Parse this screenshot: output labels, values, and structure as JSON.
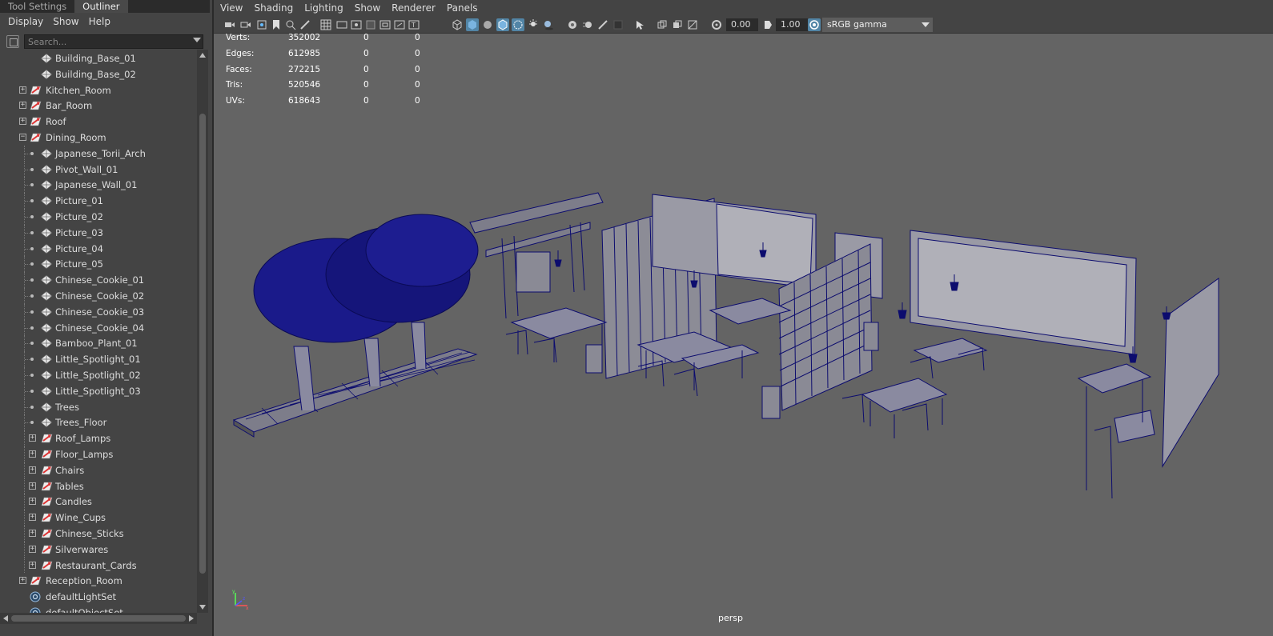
{
  "left_panel": {
    "tabs": [
      "Tool Settings",
      "Outliner"
    ],
    "menu": [
      "Display",
      "Show",
      "Help"
    ],
    "search_placeholder": "Search...",
    "items": [
      {
        "label": "Building_Base_01",
        "level": 1,
        "type": "mesh",
        "expander": "none"
      },
      {
        "label": "Building_Base_02",
        "level": 1,
        "type": "mesh",
        "expander": "none"
      },
      {
        "label": "Kitchen_Room",
        "level": 0,
        "type": "group",
        "expander": "plus"
      },
      {
        "label": "Bar_Room",
        "level": 0,
        "type": "group",
        "expander": "plus"
      },
      {
        "label": "Roof",
        "level": 0,
        "type": "group",
        "expander": "plus"
      },
      {
        "label": "Dining_Room",
        "level": 0,
        "type": "group",
        "expander": "minus"
      },
      {
        "label": "Japanese_Torii_Arch",
        "level": 2,
        "type": "mesh",
        "expander": "none"
      },
      {
        "label": "Pivot_Wall_01",
        "level": 2,
        "type": "mesh",
        "expander": "none"
      },
      {
        "label": "Japanese_Wall_01",
        "level": 2,
        "type": "mesh",
        "expander": "none"
      },
      {
        "label": "Picture_01",
        "level": 2,
        "type": "mesh",
        "expander": "none"
      },
      {
        "label": "Picture_02",
        "level": 2,
        "type": "mesh",
        "expander": "none"
      },
      {
        "label": "Picture_03",
        "level": 2,
        "type": "mesh",
        "expander": "none"
      },
      {
        "label": "Picture_04",
        "level": 2,
        "type": "mesh",
        "expander": "none"
      },
      {
        "label": "Picture_05",
        "level": 2,
        "type": "mesh",
        "expander": "none"
      },
      {
        "label": "Chinese_Cookie_01",
        "level": 2,
        "type": "mesh",
        "expander": "none"
      },
      {
        "label": "Chinese_Cookie_02",
        "level": 2,
        "type": "mesh",
        "expander": "none"
      },
      {
        "label": "Chinese_Cookie_03",
        "level": 2,
        "type": "mesh",
        "expander": "none"
      },
      {
        "label": "Chinese_Cookie_04",
        "level": 2,
        "type": "mesh",
        "expander": "none"
      },
      {
        "label": "Bamboo_Plant_01",
        "level": 2,
        "type": "mesh",
        "expander": "none"
      },
      {
        "label": "Little_Spotlight_01",
        "level": 2,
        "type": "mesh",
        "expander": "none"
      },
      {
        "label": "Little_Spotlight_02",
        "level": 2,
        "type": "mesh",
        "expander": "none"
      },
      {
        "label": "Little_Spotlight_03",
        "level": 2,
        "type": "mesh",
        "expander": "none"
      },
      {
        "label": "Trees",
        "level": 2,
        "type": "mesh",
        "expander": "none"
      },
      {
        "label": "Trees_Floor",
        "level": 2,
        "type": "mesh",
        "expander": "none"
      },
      {
        "label": "Roof_Lamps",
        "level": 1,
        "type": "group",
        "expander": "plus"
      },
      {
        "label": "Floor_Lamps",
        "level": 1,
        "type": "group",
        "expander": "plus"
      },
      {
        "label": "Chairs",
        "level": 1,
        "type": "group",
        "expander": "plus"
      },
      {
        "label": "Tables",
        "level": 1,
        "type": "group",
        "expander": "plus"
      },
      {
        "label": "Candles",
        "level": 1,
        "type": "group",
        "expander": "plus"
      },
      {
        "label": "Wine_Cups",
        "level": 1,
        "type": "group",
        "expander": "plus"
      },
      {
        "label": "Chinese_Sticks",
        "level": 1,
        "type": "group",
        "expander": "plus"
      },
      {
        "label": "Silverwares",
        "level": 1,
        "type": "group",
        "expander": "plus"
      },
      {
        "label": "Restaurant_Cards",
        "level": 1,
        "type": "group",
        "expander": "plus"
      },
      {
        "label": "Reception_Room",
        "level": 0,
        "type": "group",
        "expander": "plus"
      },
      {
        "label": "defaultLightSet",
        "level": 0,
        "type": "set",
        "expander": "none"
      },
      {
        "label": "defaultObjectSet",
        "level": 0,
        "type": "set",
        "expander": "none"
      }
    ]
  },
  "viewport": {
    "menu": [
      "View",
      "Shading",
      "Lighting",
      "Show",
      "Renderer",
      "Panels"
    ],
    "exposure": "0.00",
    "gamma": "1.00",
    "color_space": "sRGB gamma",
    "camera": "persp",
    "hud": [
      {
        "label": "Verts:",
        "v1": "352002",
        "v2": "0",
        "v3": "0"
      },
      {
        "label": "Edges:",
        "v1": "612985",
        "v2": "0",
        "v3": "0"
      },
      {
        "label": "Faces:",
        "v1": "272215",
        "v2": "0",
        "v3": "0"
      },
      {
        "label": "Tris:",
        "v1": "520546",
        "v2": "0",
        "v3": "0"
      },
      {
        "label": "UVs:",
        "v1": "618643",
        "v2": "0",
        "v3": "0"
      }
    ],
    "axis_labels": {
      "y": "y",
      "x": "x",
      "z": "z"
    }
  },
  "colors": {
    "wireframe": "#0c0c6e",
    "viewport_bg": "#646464",
    "panel_bg": "#444444",
    "highlight": "#5285a6"
  }
}
